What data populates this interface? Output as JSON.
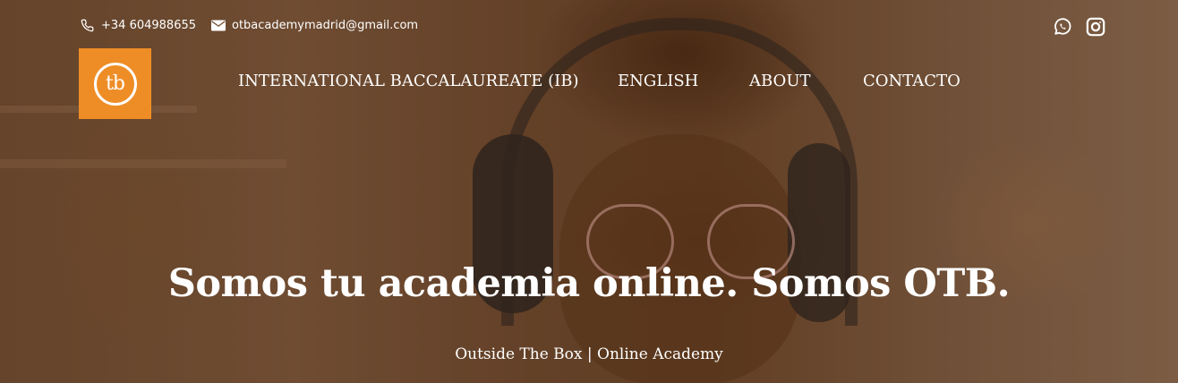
{
  "colors": {
    "accent": "#ee8d26",
    "text": "#ffffff"
  },
  "topbar": {
    "phone": "+34 604988655",
    "phone_icon": "phone-icon",
    "email": "otbacademymadrid@gmail.com",
    "email_icon": "envelope-icon",
    "social": [
      "whatsapp-icon",
      "instagram-icon"
    ]
  },
  "logo": {
    "text": "tb"
  },
  "nav": {
    "items": [
      "INTERNATIONAL BACCALAUREATE (IB)",
      "ENGLISH",
      "ABOUT",
      "CONTACTO"
    ]
  },
  "hero": {
    "headline": "Somos tu academia online. Somos OTB.",
    "subline": "Outside The Box | Online Academy"
  }
}
